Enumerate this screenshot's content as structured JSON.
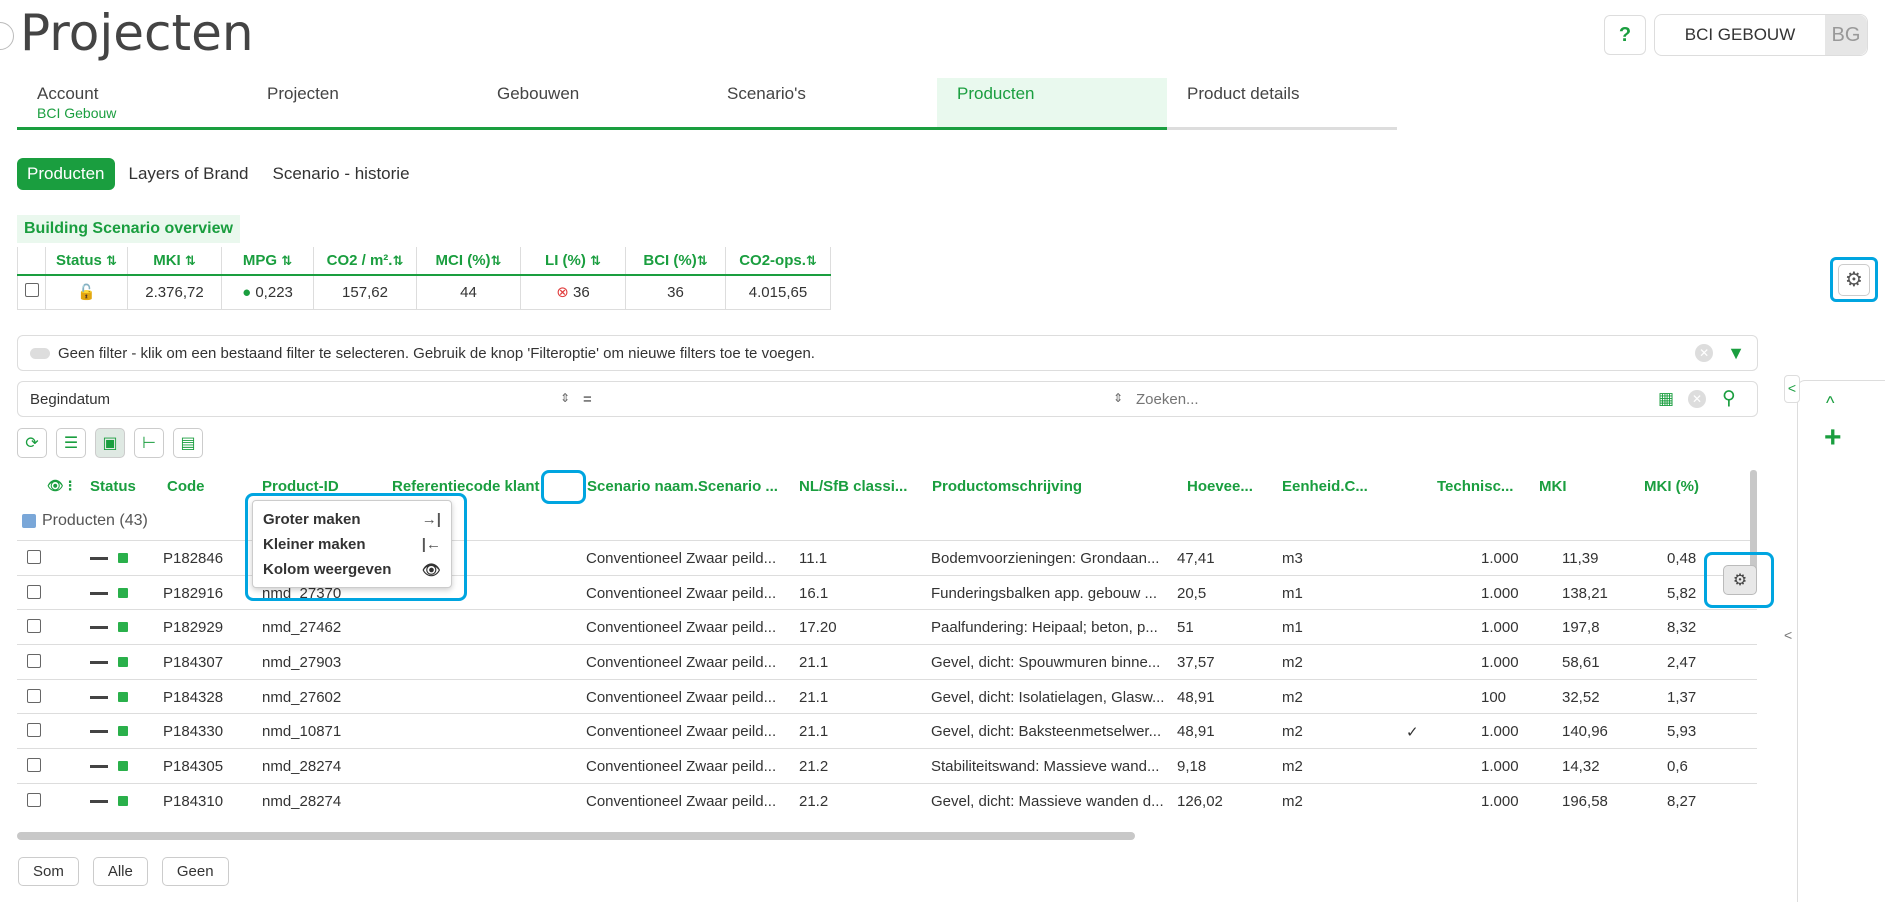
{
  "page": {
    "title": "Projecten"
  },
  "header": {
    "help": "?",
    "user_name": "BCI GEBOUW",
    "user_initials": "BG"
  },
  "tabs": [
    {
      "label": "Account",
      "sub": "BCI Gebouw"
    },
    {
      "label": "Projecten"
    },
    {
      "label": "Gebouwen"
    },
    {
      "label": "Scenario's"
    },
    {
      "label": "Producten"
    },
    {
      "label": "Product details"
    }
  ],
  "subtabs": [
    "Producten",
    "Layers of Brand",
    "Scenario - historie"
  ],
  "overview": {
    "title": "Building Scenario overview",
    "headers": [
      "Status",
      "MKI",
      "MPG",
      "CO2 / m².",
      "MCI (%)",
      "LI (%)",
      "BCI (%)",
      "CO2-ops."
    ],
    "values": [
      "2.376,72",
      "0,223",
      "157,62",
      "44",
      "36",
      "36",
      "4.015,65"
    ]
  },
  "filter": {
    "text": "Geen filter - klik om een bestaand filter te selecteren. Gebruik de knop 'Filteroptie' om nieuwe filters toe te voegen."
  },
  "search": {
    "field": "Begindatum",
    "operator": "=",
    "placeholder": "Zoeken..."
  },
  "grid": {
    "headers": [
      "Status",
      "Code",
      "Product-ID",
      "Referentiecode klant",
      "Scenario naam.Scenario ...",
      "NL/SfB classi...",
      "Productomschrijving",
      "Hoevee...",
      "Eenheid.C...",
      "Technisc...",
      "MKI",
      "MKI (%)"
    ],
    "group": "Producten (43)",
    "rows": [
      {
        "code": "P182846",
        "pid": "",
        "scen": "Conventioneel Zwaar peild...",
        "nlsfb": "11.1",
        "desc": "Bodemvoorzieningen: Grondaan...",
        "qty": "47,41",
        "unit": "m3",
        "tech": "",
        "lev": "1.000",
        "mki": "11,39",
        "pct": "0,48"
      },
      {
        "code": "P182916",
        "pid": "nmd_27370",
        "scen": "Conventioneel Zwaar peild...",
        "nlsfb": "16.1",
        "desc": "Funderingsbalken app. gebouw ...",
        "qty": "20,5",
        "unit": "m1",
        "tech": "",
        "lev": "1.000",
        "mki": "138,21",
        "pct": "5,82"
      },
      {
        "code": "P182929",
        "pid": "nmd_27462",
        "scen": "Conventioneel Zwaar peild...",
        "nlsfb": "17.20",
        "desc": "Paalfundering: Heipaal; beton, p...",
        "qty": "51",
        "unit": "m1",
        "tech": "",
        "lev": "1.000",
        "mki": "197,8",
        "pct": "8,32"
      },
      {
        "code": "P184307",
        "pid": "nmd_27903",
        "scen": "Conventioneel Zwaar peild...",
        "nlsfb": "21.1",
        "desc": "Gevel, dicht: Spouwmuren binne...",
        "qty": "37,57",
        "unit": "m2",
        "tech": "",
        "lev": "1.000",
        "mki": "58,61",
        "pct": "2,47"
      },
      {
        "code": "P184328",
        "pid": "nmd_27602",
        "scen": "Conventioneel Zwaar peild...",
        "nlsfb": "21.1",
        "desc": "Gevel, dicht: Isolatielagen, Glasw...",
        "qty": "48,91",
        "unit": "m2",
        "tech": "",
        "lev": "100",
        "mki": "32,52",
        "pct": "1,37"
      },
      {
        "code": "P184330",
        "pid": "nmd_10871",
        "scen": "Conventioneel Zwaar peild...",
        "nlsfb": "21.1",
        "desc": "Gevel, dicht: Baksteenmetselwer...",
        "qty": "48,91",
        "unit": "m2",
        "tech": "✓",
        "lev": "1.000",
        "mki": "140,96",
        "pct": "5,93"
      },
      {
        "code": "P184305",
        "pid": "nmd_28274",
        "scen": "Conventioneel Zwaar peild...",
        "nlsfb": "21.2",
        "desc": "Stabiliteitswand: Massieve wand...",
        "qty": "9,18",
        "unit": "m2",
        "tech": "",
        "lev": "1.000",
        "mki": "14,32",
        "pct": "0,6"
      },
      {
        "code": "P184310",
        "pid": "nmd_28274",
        "scen": "Conventioneel Zwaar peild...",
        "nlsfb": "21.2",
        "desc": "Gevel, dicht: Massieve wanden d...",
        "qty": "126,02",
        "unit": "m2",
        "tech": "",
        "lev": "1.000",
        "mki": "196,58",
        "pct": "8,27"
      }
    ]
  },
  "context_menu": [
    "Groter maken",
    "Kleiner maken",
    "Kolom weergeven"
  ],
  "footer_buttons": [
    "Som",
    "Alle",
    "Geen"
  ],
  "side": {
    "up": "^",
    "add": "+",
    "collapse": "<"
  }
}
